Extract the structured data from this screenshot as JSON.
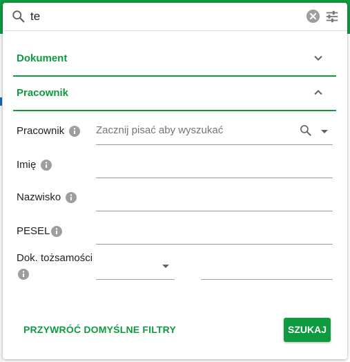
{
  "search": {
    "value": "te"
  },
  "sections": {
    "document": {
      "title": "Dokument",
      "expanded": false
    },
    "employee": {
      "title": "Pracownik",
      "expanded": true
    }
  },
  "fields": {
    "employee": {
      "label": "Pracownik",
      "placeholder": "Zacznij pisać aby wyszukać"
    },
    "first_name": {
      "label": "Imię"
    },
    "last_name": {
      "label": "Nazwisko"
    },
    "pesel": {
      "label": "PESEL"
    },
    "id_document": {
      "label": "Dok. tożsamości"
    }
  },
  "actions": {
    "reset_label": "PRZYWRÓĆ DOMYŚLNE FILTRY",
    "submit_label": "SZUKAJ"
  },
  "colors": {
    "accent": "#0e9a3e",
    "icon_grey": "#9e9e9e",
    "text": "#212121"
  },
  "icons": [
    "search-icon",
    "clear-icon",
    "tune-icon",
    "chevron-down-icon",
    "chevron-up-icon",
    "info-icon",
    "dropdown-arrow-icon"
  ]
}
